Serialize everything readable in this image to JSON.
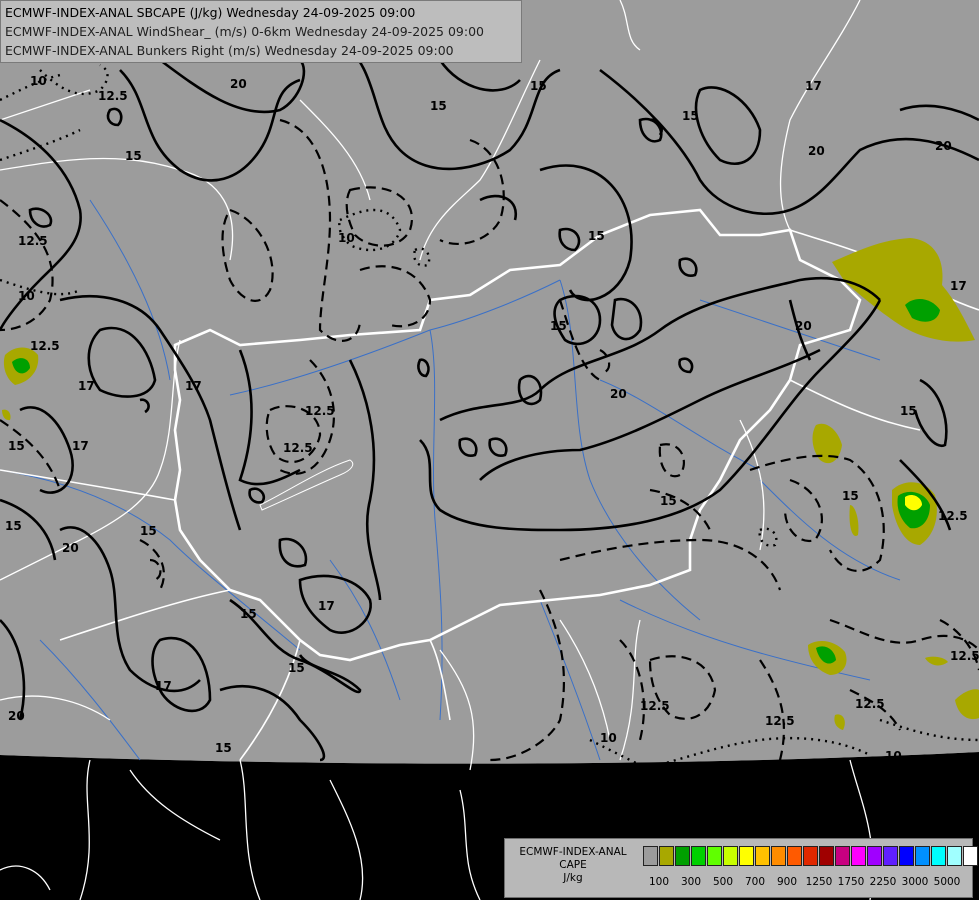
{
  "titles": [
    "ECMWF-INDEX-ANAL SBCAPE (J/kg) Wednesday 24-09-2025 09:00",
    "ECMWF-INDEX-ANAL WindShear_ (m/s) 0-6km Wednesday 24-09-2025 09:00",
    "ECMWF-INDEX-ANAL Bunkers Right (m/s) Wednesday 24-09-2025 09:00"
  ],
  "legend": {
    "title_line1": "ECMWF-INDEX-ANAL",
    "title_line2": "CAPE",
    "unit": "J/kg",
    "colors": [
      "#9c9c9c",
      "#a8a800",
      "#00a000",
      "#00d000",
      "#60ff00",
      "#c8ff00",
      "#ffff00",
      "#ffc000",
      "#ff8c00",
      "#ff5a00",
      "#e02800",
      "#a00000",
      "#c80080",
      "#ff00ff",
      "#a000ff",
      "#6020ff",
      "#0000ff",
      "#0090ff",
      "#00ffff",
      "#a0ffff",
      "#ffffff"
    ],
    "ticks": [
      "100",
      "300",
      "500",
      "700",
      "900",
      "1250",
      "1750",
      "2250",
      "3000",
      "5000"
    ]
  },
  "contour_labels": [
    "10",
    "12.5",
    "15",
    "17",
    "20"
  ],
  "colors": {
    "land": "#9c9c9c",
    "outside": "#000000",
    "borders": "#ffffff",
    "rivers": "#3a70c8",
    "contours": "#000000"
  }
}
